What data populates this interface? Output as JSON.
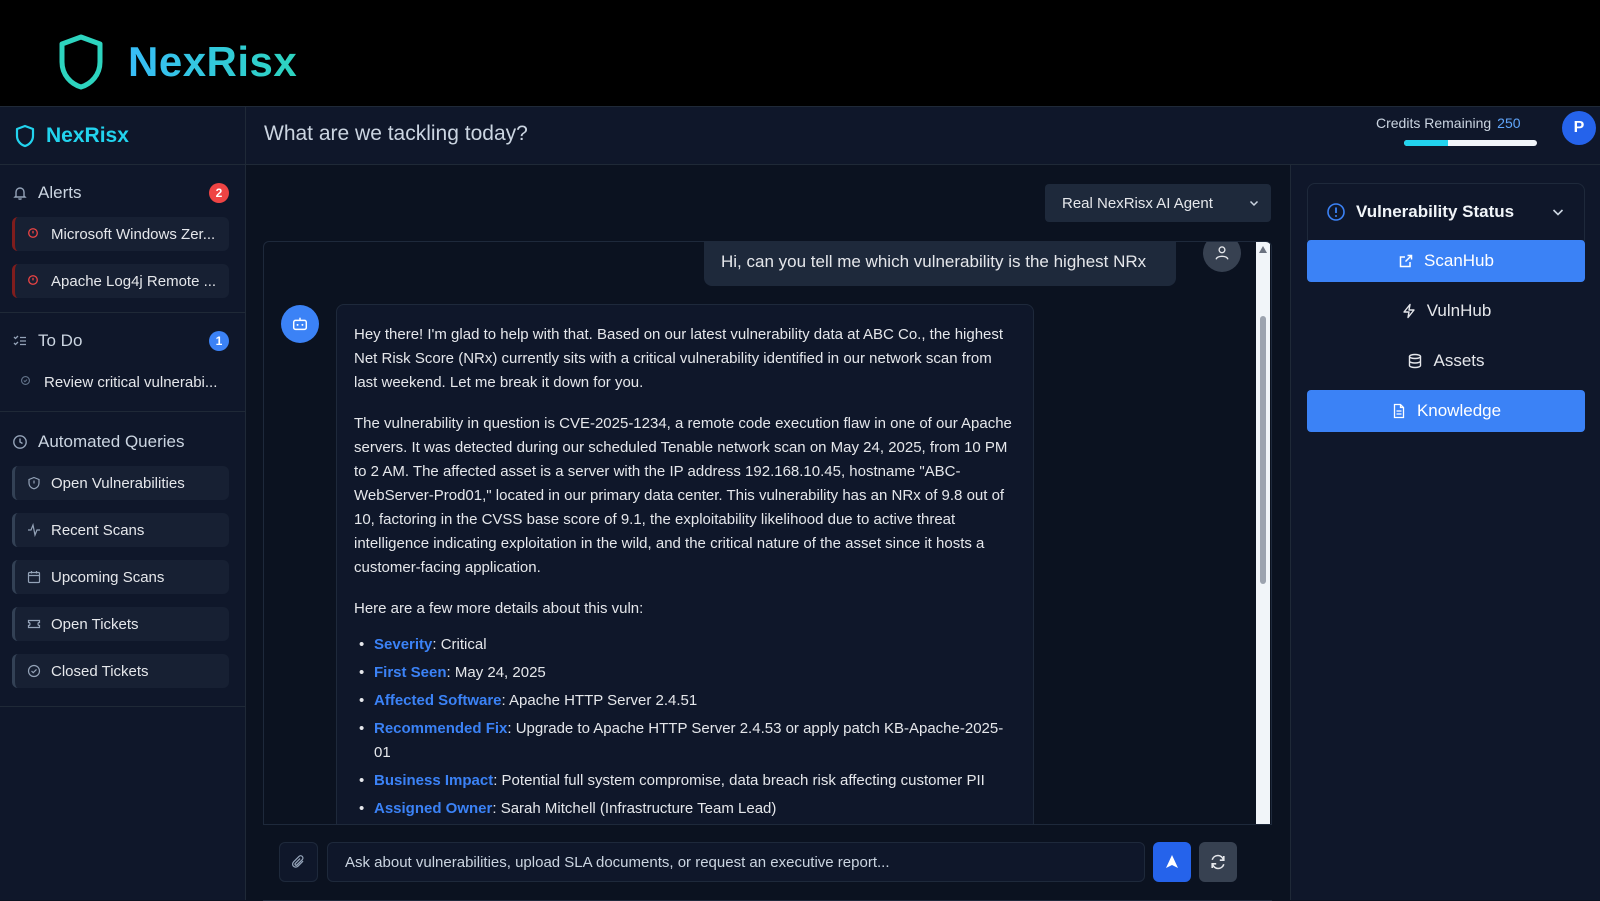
{
  "banner": {
    "title": "NexRisx"
  },
  "sidebar": {
    "brand": "NexRisx",
    "alerts": {
      "label": "Alerts",
      "count": "2",
      "items": [
        "Microsoft Windows Zer...",
        "Apache Log4j Remote ..."
      ]
    },
    "todo": {
      "label": "To Do",
      "count": "1",
      "items": [
        "Review critical vulnerabi..."
      ]
    },
    "queries": {
      "label": "Automated Queries",
      "items": [
        "Open Vulnerabilities",
        "Recent Scans",
        "Upcoming Scans",
        "Open Tickets",
        "Closed Tickets"
      ]
    }
  },
  "topbar": {
    "prompt": "What are we tackling today?",
    "credits_label": "Credits Remaining",
    "credits_value": "250",
    "credits_fraction": 0.33,
    "avatar_initial": "P"
  },
  "chat": {
    "agent": "Real NexRisx AI Agent",
    "user_message": "Hi, can you tell me which vulnerability is the highest NRx",
    "bot_paragraphs": [
      "Hey there! I'm glad to help with that. Based on our latest vulnerability data at ABC Co., the highest Net Risk Score (NRx) currently sits with a critical vulnerability identified in our network scan from last weekend. Let me break it down for you.",
      "The vulnerability in question is CVE-2025-1234, a remote code execution flaw in one of our Apache servers. It was detected during our scheduled Tenable network scan on May 24, 2025, from 10 PM to 2 AM. The affected asset is a server with the IP address 192.168.10.45, hostname \"ABC-WebServer-Prod01,\" located in our primary data center. This vulnerability has an NRx of 9.8 out of 10, factoring in the CVSS base score of 9.1, the exploitability likelihood due to active threat intelligence indicating exploitation in the wild, and the critical nature of the asset since it hosts a customer-facing application.",
      "Here are a few more details about this vuln:"
    ],
    "details": [
      {
        "key": "Severity",
        "value": ": Critical"
      },
      {
        "key": "First Seen",
        "value": ": May 24, 2025"
      },
      {
        "key": "Affected Software",
        "value": ": Apache HTTP Server 2.4.51"
      },
      {
        "key": "Recommended Fix",
        "value": ": Upgrade to Apache HTTP Server 2.4.53 or apply patch KB-Apache-2025-01"
      },
      {
        "key": "Business Impact",
        "value": ": Potential full system compromise, data breach risk affecting customer PII"
      },
      {
        "key": "Assigned Owner",
        "value": ": Sarah Mitchell (Infrastructure Team Lead)"
      }
    ],
    "input_placeholder": "Ask about vulnerabilities, upload SLA documents, or request an executive report..."
  },
  "right_panel": {
    "title": "Vulnerability Status",
    "buttons": [
      "ScanHub",
      "VulnHub",
      "Assets",
      "Knowledge"
    ]
  },
  "colors": {
    "accent": "#3b82f6",
    "brand": "#22d3ee",
    "alert": "#ef4444",
    "background": "#0b1220"
  }
}
